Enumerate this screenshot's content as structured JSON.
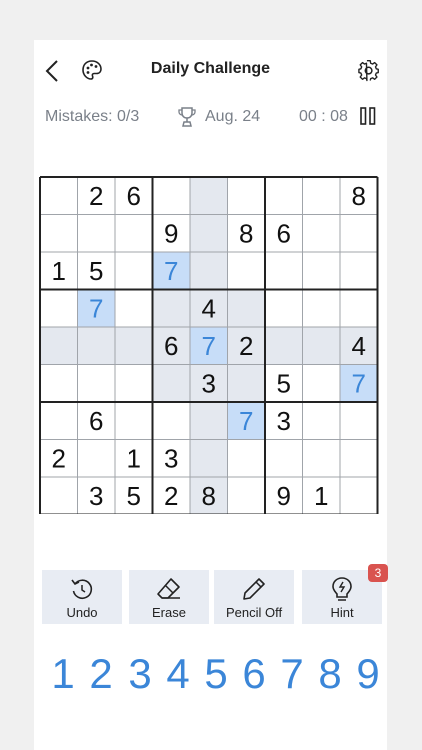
{
  "header": {
    "title": "Daily Challenge",
    "back_icon": "chevron-left-icon",
    "theme_icon": "palette-icon",
    "settings_icon": "gear-icon"
  },
  "status": {
    "mistakes": "Mistakes: 0/3",
    "date": "Aug. 24",
    "timer": "00 : 08",
    "trophy_icon": "trophy-icon",
    "pause_icon": "pause-icon"
  },
  "colors": {
    "given": "#111111",
    "user": "#3b86d8",
    "highlight": "#e4e8ef",
    "selected": "#c7ddf8",
    "grid_thin": "#a0a4aa",
    "grid_thick": "#222222"
  },
  "board": {
    "given": [
      "_26_____8",
      "___9_86__",
      "15_______",
      "____4____",
      "___6_2__4",
      "____3_5__",
      "_6____3__",
      "2_13_____",
      "_3528_91_"
    ],
    "user": [
      "_________",
      "_________",
      "___7_____",
      "_7_______",
      "____7____",
      "________7",
      "_____7___",
      "_________",
      "_________"
    ],
    "selected_row": 4,
    "selected_col": 4,
    "selected_value": "7"
  },
  "tools": [
    {
      "label": "Undo",
      "icon": "undo-icon"
    },
    {
      "label": "Erase",
      "icon": "eraser-icon"
    },
    {
      "label": "Pencil Off",
      "icon": "pencil-icon"
    },
    {
      "label": "Hint",
      "icon": "lightbulb-icon",
      "badge": "3"
    }
  ],
  "numpad": [
    "1",
    "2",
    "3",
    "4",
    "5",
    "6",
    "7",
    "8",
    "9"
  ]
}
